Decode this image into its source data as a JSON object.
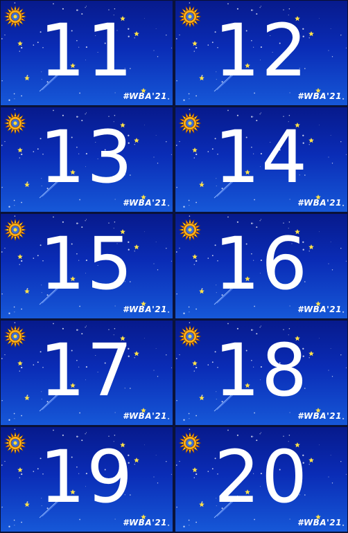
{
  "cards": [
    {
      "number": "11",
      "tag": "#WBA'21"
    },
    {
      "number": "12",
      "tag": "#WBA'21"
    },
    {
      "number": "13",
      "tag": "#WBA'21"
    },
    {
      "number": "14",
      "tag": "#WBA'21"
    },
    {
      "number": "15",
      "tag": "#WBA'21"
    },
    {
      "number": "16",
      "tag": "#WBA'21"
    },
    {
      "number": "17",
      "tag": "#WBA'21"
    },
    {
      "number": "18",
      "tag": "#WBA'21"
    },
    {
      "number": "19",
      "tag": "#WBA'21"
    },
    {
      "number": "20",
      "tag": "#WBA'21"
    }
  ],
  "icons": {
    "sun": "sun-emblem-icon",
    "star": "star-icon",
    "comet": "comet-icon"
  },
  "colors": {
    "sky_top": "#071a8c",
    "sky_bottom": "#1658d8",
    "text": "#ffffff",
    "star": "#ffe14a"
  }
}
